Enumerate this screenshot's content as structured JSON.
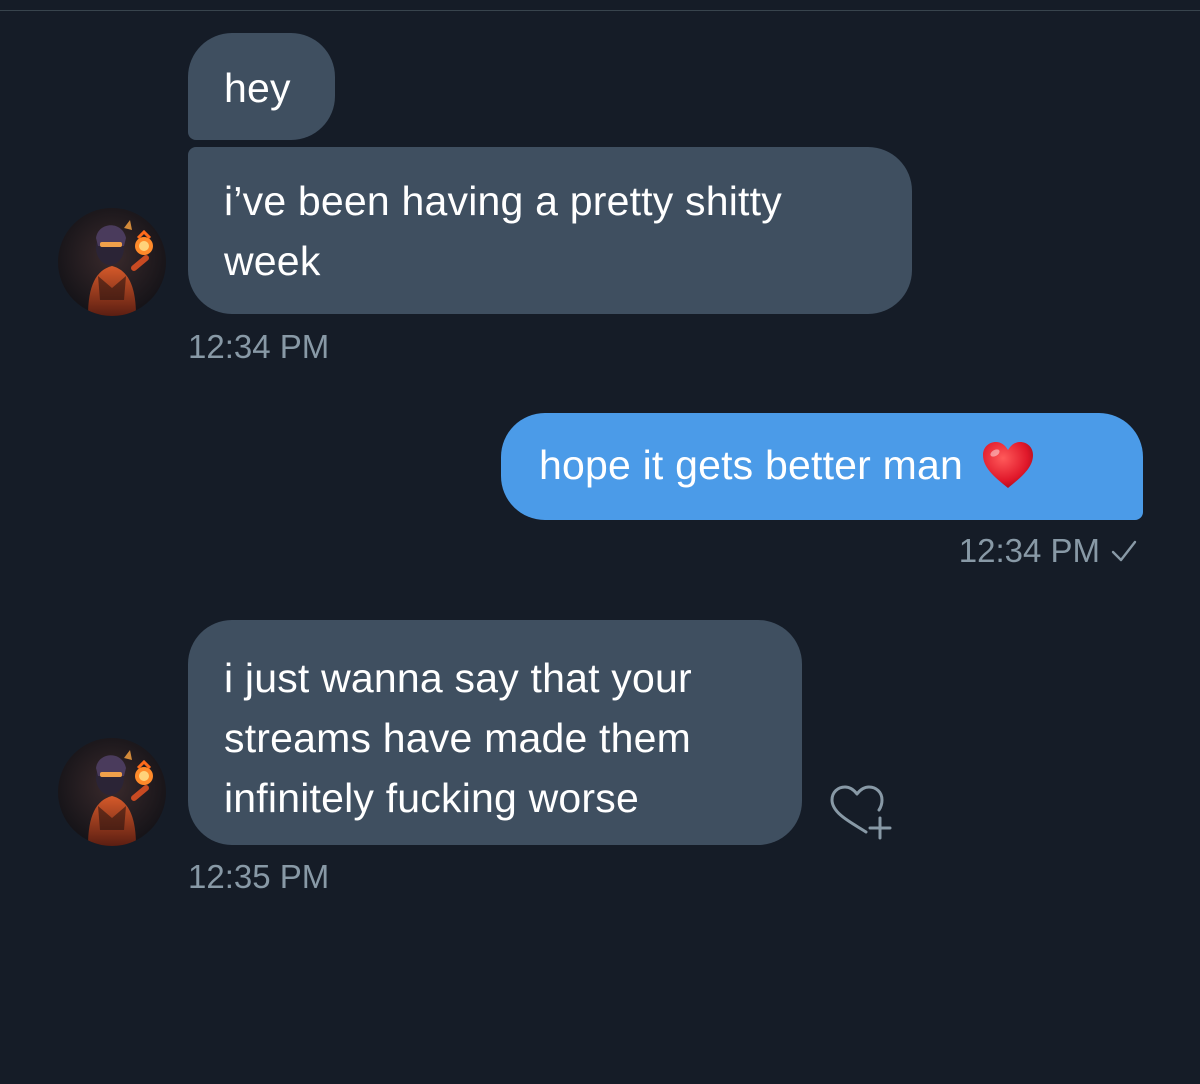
{
  "conversation": {
    "messages": [
      {
        "direction": "incoming",
        "text": "hey"
      },
      {
        "direction": "incoming",
        "text": "i’ve been having a pretty shitty week",
        "line1": "i’ve been having a pretty shitty",
        "line2": "week",
        "timestamp": "12:34 PM"
      },
      {
        "direction": "outgoing",
        "text": "hope it gets better man",
        "emoji": "red-heart",
        "timestamp": "12:34 PM",
        "status": "sent-check"
      },
      {
        "direction": "incoming",
        "text": "i just wanna say that your streams have made them infinitely fucking worse",
        "line1": "i just wanna say that your",
        "line2": "streams have made them",
        "line3": "infinitely fucking worse",
        "timestamp": "12:35 PM"
      }
    ]
  },
  "icons": {
    "read_receipt": "check-icon",
    "like_reaction": "heart-plus-icon",
    "emoji": "red-heart-icon"
  },
  "colors": {
    "background": "#151c27",
    "incoming_bubble": "#3f4f60",
    "outgoing_bubble": "#4b9be8",
    "timestamp_text": "#8899a6"
  }
}
